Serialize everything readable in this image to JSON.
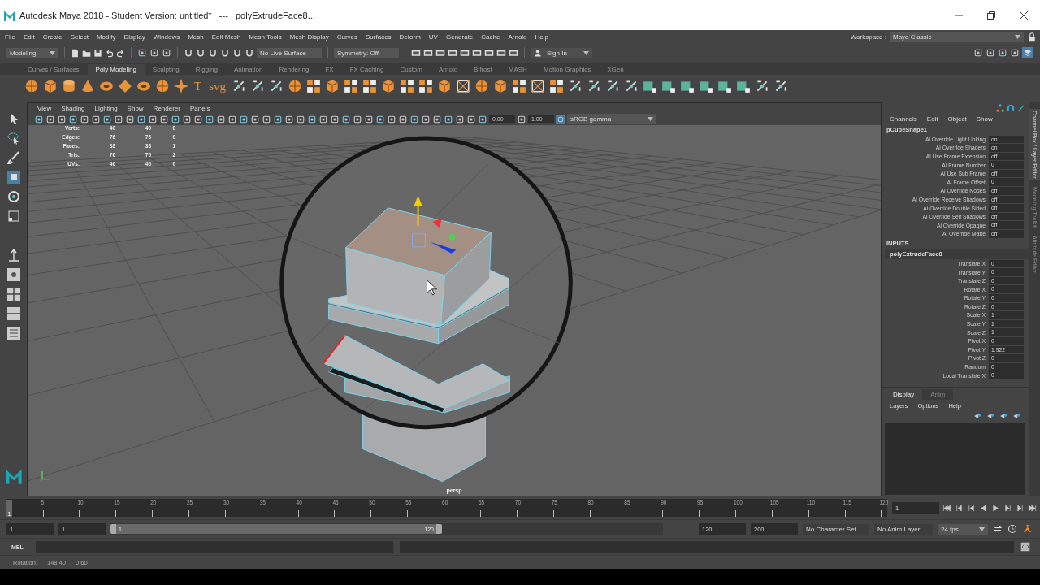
{
  "window": {
    "title": "Autodesk Maya 2018 - Student Version: untitled*   ---   polyExtrudeFace8..."
  },
  "menu_bar": {
    "items": [
      "File",
      "Edit",
      "Create",
      "Select",
      "Modify",
      "Display",
      "Windows",
      "Mesh",
      "Edit Mesh",
      "Mesh Tools",
      "Mesh Display",
      "Curves",
      "Surfaces",
      "Deform",
      "UV",
      "Generate",
      "Cache",
      "Arnold",
      "Help"
    ],
    "workspace_label": "Workspace :",
    "workspace": "Maya Classic"
  },
  "status_line": {
    "mode": "Modeling",
    "live_surface": "No Live Surface",
    "symmetry": "Symmetry: Off",
    "sign_in": "Sign In"
  },
  "shelf": {
    "tabs": [
      {
        "label": "Curves / Surfaces",
        "selected": false
      },
      {
        "label": "Poly Modeling",
        "selected": true
      },
      {
        "label": "Sculpting",
        "selected": false
      },
      {
        "label": "Rigging",
        "selected": false
      },
      {
        "label": "Animation",
        "selected": false
      },
      {
        "label": "Rendering",
        "selected": false
      },
      {
        "label": "FX",
        "selected": false
      },
      {
        "label": "FX Caching",
        "selected": false
      },
      {
        "label": "Custom",
        "selected": false
      },
      {
        "label": "Arnold",
        "selected": false
      },
      {
        "label": "Bifrost",
        "selected": false
      },
      {
        "label": "MASH",
        "selected": false
      },
      {
        "label": "Motion Graphics",
        "selected": false
      },
      {
        "label": "XGen",
        "selected": false
      }
    ],
    "icons": [
      {
        "kind": "sphere"
      },
      {
        "kind": "cube"
      },
      {
        "kind": "cylinder"
      },
      {
        "kind": "cone"
      },
      {
        "kind": "torus"
      },
      {
        "kind": "diamond"
      },
      {
        "kind": "torus"
      },
      {
        "kind": "sphere"
      },
      {
        "kind": "star"
      },
      {
        "kind": "glyph",
        "label": "T"
      },
      {
        "kind": "glyph",
        "label": "svg"
      },
      {
        "kind": "tool"
      },
      {
        "kind": "tool"
      },
      {
        "kind": "tool"
      },
      {
        "kind": "sphere"
      },
      {
        "kind": "tiles"
      },
      {
        "kind": "cube"
      },
      {
        "kind": "tiles"
      },
      {
        "kind": "tiles"
      },
      {
        "kind": "cube"
      },
      {
        "kind": "tiles"
      },
      {
        "kind": "tiles"
      },
      {
        "kind": "cube"
      },
      {
        "kind": "frame"
      },
      {
        "kind": "sphere"
      },
      {
        "kind": "cube"
      },
      {
        "kind": "tiles"
      },
      {
        "kind": "frame"
      },
      {
        "kind": "tiles"
      },
      {
        "kind": "tool"
      },
      {
        "kind": "tool"
      },
      {
        "kind": "tool"
      },
      {
        "kind": "tool"
      },
      {
        "kind": "teal"
      },
      {
        "kind": "teal"
      },
      {
        "kind": "teal"
      },
      {
        "kind": "teal"
      },
      {
        "kind": "teal"
      },
      {
        "kind": "teal"
      },
      {
        "kind": "tool"
      },
      {
        "kind": "tool"
      }
    ]
  },
  "viewport": {
    "menus": [
      "View",
      "Shading",
      "Lighting",
      "Show",
      "Renderer",
      "Panels"
    ],
    "exposure": "0.00",
    "gamma": "1.00",
    "color_space": "sRGB gamma",
    "hud": [
      {
        "label": "Verts:",
        "values": [
          "40",
          "40",
          "0"
        ]
      },
      {
        "label": "Edges:",
        "values": [
          "76",
          "76",
          "0"
        ]
      },
      {
        "label": "Faces:",
        "values": [
          "38",
          "38",
          "1"
        ]
      },
      {
        "label": "Tris:",
        "values": [
          "76",
          "76",
          "2"
        ]
      },
      {
        "label": "UVs:",
        "values": [
          "46",
          "46",
          "0"
        ]
      }
    ],
    "camera": "persp"
  },
  "channel_box": {
    "menus": [
      "Channels",
      "Edit",
      "Object",
      "Show"
    ],
    "shape": {
      "name": "pCubeShape1",
      "channels": [
        {
          "label": "Ai Override Light Linking",
          "value": "on"
        },
        {
          "label": "Ai Override Shaders",
          "value": "on"
        },
        {
          "label": "Ai Use Frame Extension",
          "value": "off"
        },
        {
          "label": "Ai Frame Number",
          "value": "0"
        },
        {
          "label": "Ai Use Sub Frame",
          "value": "off"
        },
        {
          "label": "Ai Frame Offset",
          "value": "0"
        },
        {
          "label": "Ai Override Nodes",
          "value": "off"
        },
        {
          "label": "Ai Override Receive Shadows",
          "value": "off"
        },
        {
          "label": "Ai Override Double Sided",
          "value": "off"
        },
        {
          "label": "Ai Override Self Shadows",
          "value": "off"
        },
        {
          "label": "Ai Override Opaque",
          "value": "off"
        },
        {
          "label": "Ai Override Matte",
          "value": "off"
        }
      ]
    },
    "inputs_label": "INPUTS",
    "input": {
      "name": "polyExtrudeFace8",
      "channels": [
        {
          "label": "Translate X",
          "value": "0"
        },
        {
          "label": "Translate Y",
          "value": "0"
        },
        {
          "label": "Translate Z",
          "value": "0"
        },
        {
          "label": "Rotate X",
          "value": "0"
        },
        {
          "label": "Rotate Y",
          "value": "0"
        },
        {
          "label": "Rotate Z",
          "value": "0"
        },
        {
          "label": "Scale X",
          "value": "1"
        },
        {
          "label": "Scale Y",
          "value": "1"
        },
        {
          "label": "Scale Z",
          "value": "1"
        },
        {
          "label": "Pivot X",
          "value": "0"
        },
        {
          "label": "Pivot Y",
          "value": "1.922"
        },
        {
          "label": "Pivot Z",
          "value": "0"
        },
        {
          "label": "Random",
          "value": "0"
        },
        {
          "label": "Local Translate X",
          "value": "0"
        }
      ]
    },
    "side_tabs": [
      {
        "label": "Channel Box / Layer Editor",
        "selected": true
      },
      {
        "label": "Modeling Toolkit",
        "selected": false
      },
      {
        "label": "Attribute Editor",
        "selected": false
      }
    ]
  },
  "layer_editor": {
    "tabs": [
      {
        "label": "Display",
        "selected": true
      },
      {
        "label": "Anim",
        "selected": false
      }
    ],
    "menus": [
      "Layers",
      "Options",
      "Help"
    ]
  },
  "time_slider": {
    "ticks": [
      "5",
      "10",
      "15",
      "20",
      "25",
      "30",
      "35",
      "40",
      "45",
      "50",
      "55",
      "60",
      "65",
      "70",
      "75",
      "80",
      "85",
      "90",
      "95",
      "100",
      "105",
      "110",
      "115",
      "120"
    ],
    "current": "1",
    "level": 0,
    "frame_field": "1"
  },
  "range_slider": {
    "start": "1",
    "anim_start": "1",
    "range_start": "1",
    "range_end": "120",
    "level": 0.6,
    "playback_end": "120",
    "anim_end": "200",
    "character_set": "No Character Set",
    "anim_layer": "No Anim Layer",
    "fps": "24 fps"
  },
  "command_line": {
    "language": "MEL"
  },
  "help_line": {
    "label": "Rotation:",
    "values": [
      "148.40",
      "0.60"
    ]
  }
}
